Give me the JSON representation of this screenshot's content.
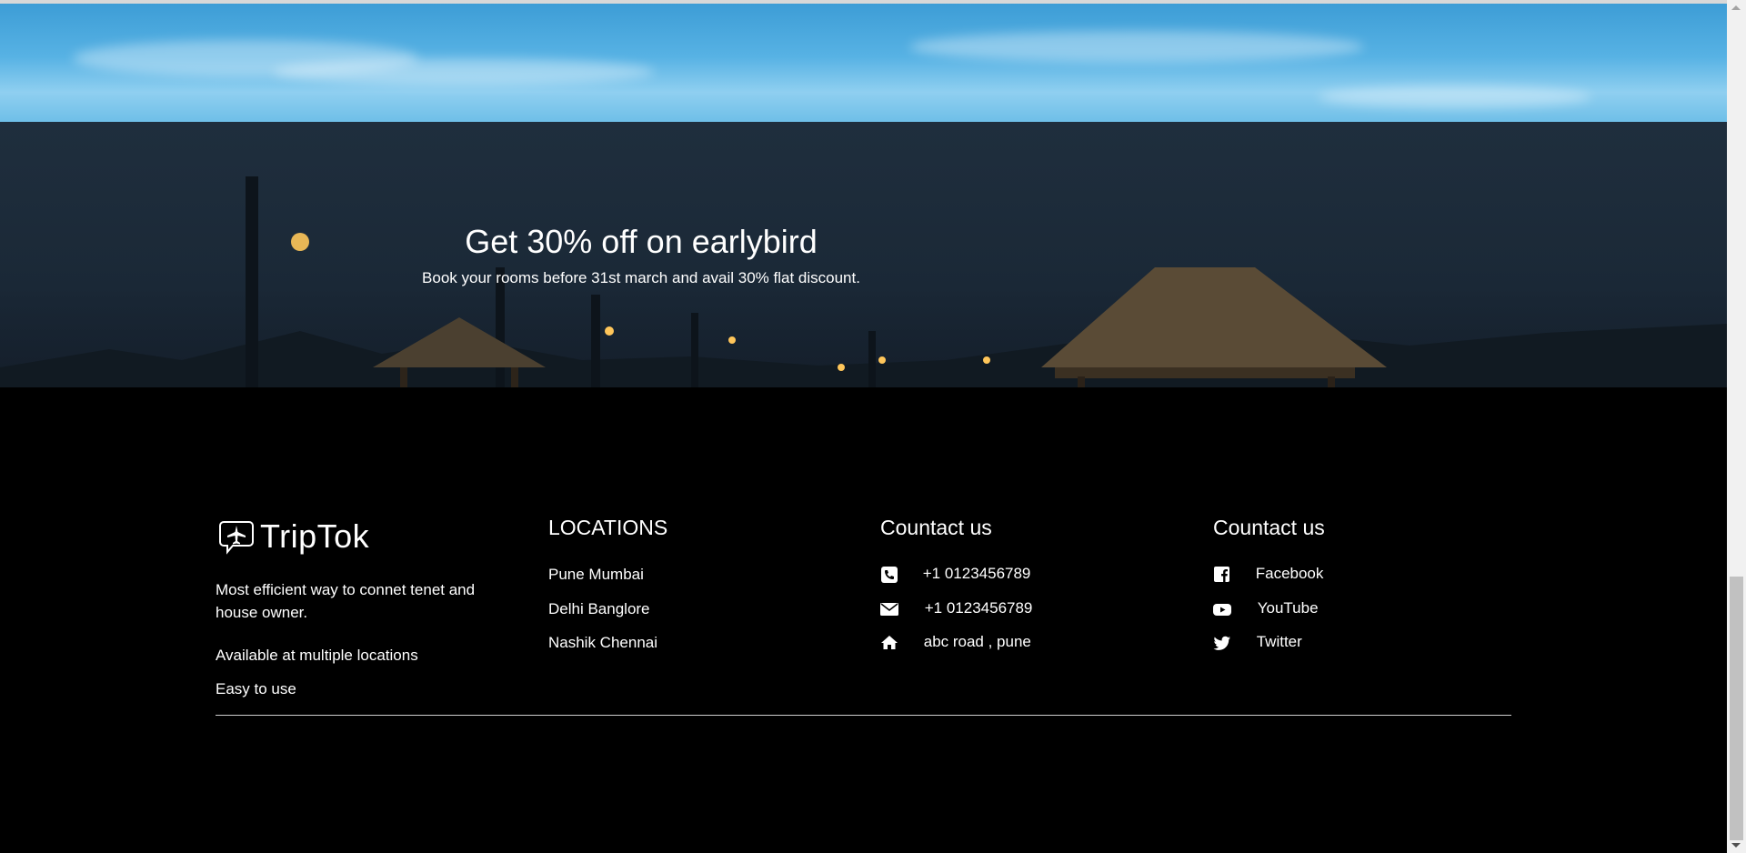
{
  "promo": {
    "title": "Get 30% off on earlybird",
    "subtitle": "Book your rooms before 31st march and avail 30% flat discount."
  },
  "brand": {
    "name": "TripTok",
    "logo_icon": "airplane-chat-icon"
  },
  "about": {
    "lines": [
      "Most efficient way to connet tenet and house owner.",
      "Available at multiple locations",
      "Easy to use"
    ]
  },
  "locations": {
    "heading": "LOCATIONS",
    "items": [
      "Pune Mumbai",
      "Delhi Banglore",
      "Nashik Chennai"
    ]
  },
  "contact": {
    "heading": "Countact us",
    "items": [
      {
        "icon": "phone-icon",
        "text": "+1 0123456789"
      },
      {
        "icon": "envelope-icon",
        "text": "+1 0123456789"
      },
      {
        "icon": "home-icon",
        "text": "abc road , pune"
      }
    ]
  },
  "social": {
    "heading": "Countact us",
    "items": [
      {
        "icon": "facebook-icon",
        "text": "Facebook"
      },
      {
        "icon": "youtube-icon",
        "text": "YouTube"
      },
      {
        "icon": "twitter-icon",
        "text": "Twitter"
      }
    ]
  },
  "colors": {
    "footer_bg": "#000000",
    "text": "#ffffff",
    "sky": "#5bb6e6"
  }
}
